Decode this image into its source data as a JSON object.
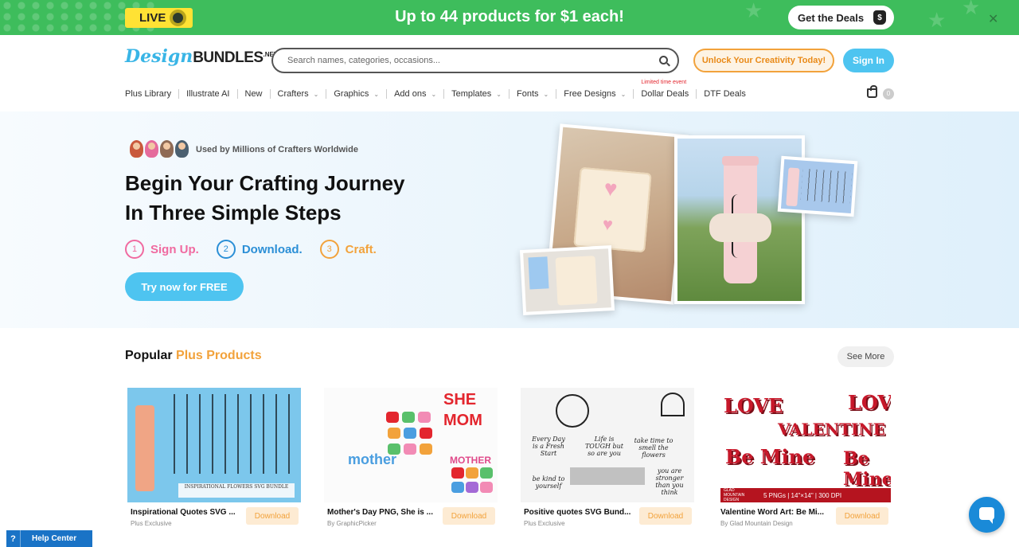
{
  "promo": {
    "live_label": "LIVE",
    "headline": "Up to 44 products for $1 each!",
    "deals_button": "Get the Deals",
    "close_glyph": "✕"
  },
  "header": {
    "logo_script": "Design",
    "logo_bold": "BUNDLES",
    "logo_suffix": ".NET",
    "search_placeholder": "Search names, categories, occasions...",
    "unlock_button": "Unlock Your Creativity Today!",
    "signin_button": "Sign In"
  },
  "nav": {
    "items": [
      {
        "label": "Plus Library"
      },
      {
        "label": "Illustrate AI"
      },
      {
        "label": "New"
      },
      {
        "label": "Crafters"
      },
      {
        "label": "Graphics"
      },
      {
        "label": "Add ons"
      },
      {
        "label": "Templates"
      },
      {
        "label": "Fonts"
      },
      {
        "label": "Free Designs"
      },
      {
        "label": "Dollar Deals"
      },
      {
        "label": "DTF Deals"
      }
    ],
    "limited_time": "Limited time event",
    "cart_count": "0"
  },
  "hero": {
    "used_by": "Used by Millions of Crafters Worldwide",
    "title_line1": "Begin Your Crafting Journey",
    "title_line2": "In Three Simple Steps",
    "steps": [
      {
        "num": "1",
        "label": "Sign Up.",
        "color": "#f06aa0"
      },
      {
        "num": "2",
        "label": "Download.",
        "color": "#2b8fd6"
      },
      {
        "num": "3",
        "label": "Craft.",
        "color": "#f2a23b"
      }
    ],
    "cta": "Try now for FREE"
  },
  "popular": {
    "title_plain": "Popular",
    "title_accent": "Plus Products",
    "see_more": "See More",
    "download_label": "Download",
    "products": [
      {
        "title": "Inspirational Quotes SVG ...",
        "subtitle": "Plus Exclusive",
        "banner": "INSPIRATIONAL FLOWERS SVG BUNDLE"
      },
      {
        "title": "Mother's Day PNG, She is ...",
        "subtitle": "By GraphicPicker"
      },
      {
        "title": "Positive quotes SVG Bund...",
        "subtitle": "Plus Exclusive"
      },
      {
        "title": "Valentine Word Art: Be Mi...",
        "subtitle": "By Glad Mountain Design",
        "footer_left": "GLAD MOUNTAIN DESIGN",
        "footer_right": "5 PNGs  |  14\"×14\"  |  300 DPI"
      }
    ]
  },
  "help": {
    "label": "Help Center",
    "glyph": "?"
  },
  "colors": {
    "brand_green": "#3ebd5c",
    "brand_blue": "#4ec4f0",
    "accent_orange": "#f2a23b"
  }
}
